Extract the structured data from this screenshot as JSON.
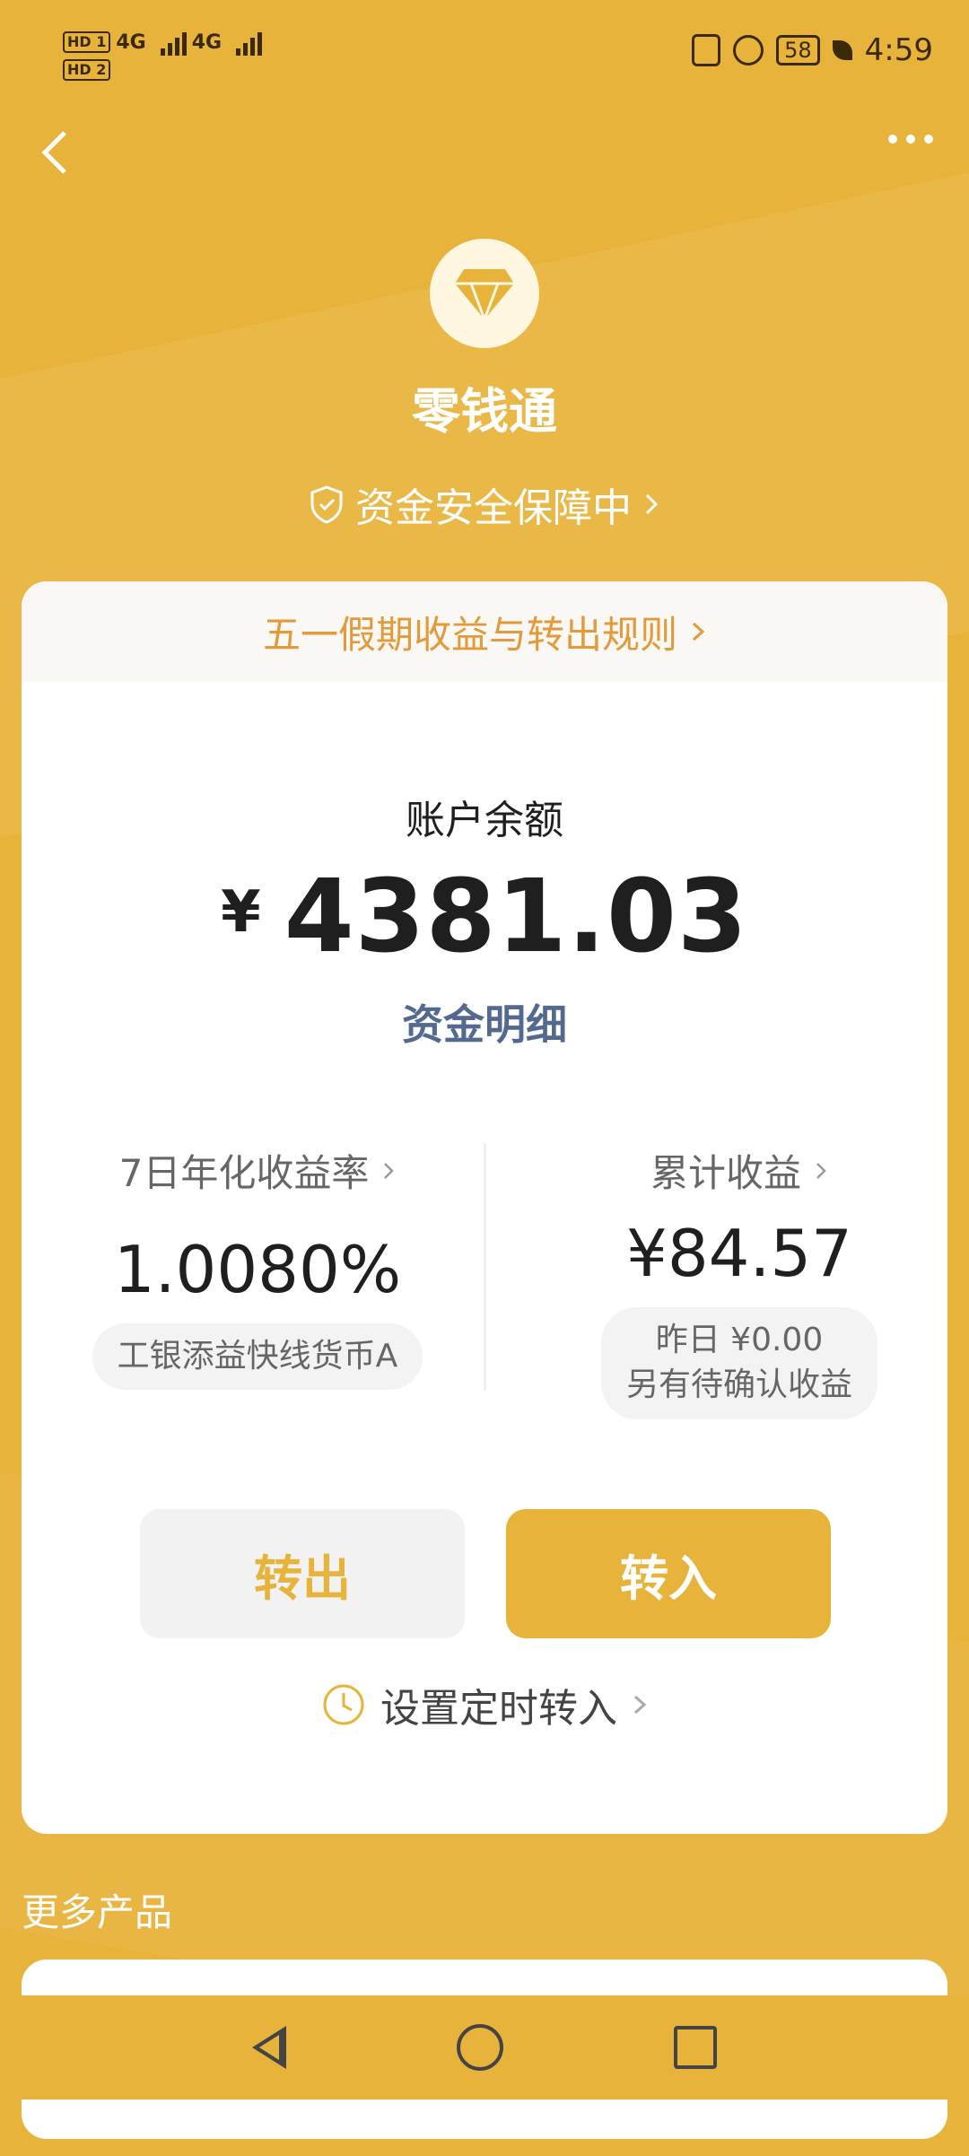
{
  "status_bar": {
    "hd1": "HD 1",
    "hd2": "HD 2",
    "net1": "4G",
    "net2": "4G",
    "battery": "58",
    "time": "4:59"
  },
  "header": {
    "title": "零钱通",
    "safety_text": "资金安全保障中",
    "logo_icon": "diamond-icon"
  },
  "card": {
    "notice_text": "五一假期收益与转出规则",
    "balance_label": "账户余额",
    "currency_symbol": "¥",
    "balance": "4381.03",
    "detail_link": "资金明细",
    "yield": {
      "label": "7日年化收益率",
      "value": "1.0080%",
      "fund_name": "工银添益快线货币A"
    },
    "earnings": {
      "label": "累计收益",
      "value": "¥84.57",
      "yesterday": "昨日 ¥0.00",
      "pending": "另有待确认收益"
    },
    "transfer_out": "转出",
    "transfer_in": "转入",
    "schedule_text": "设置定时转入"
  },
  "more_products_title": "更多产品",
  "colors": {
    "accent": "#E8B33A",
    "notice_orange": "#E39A3A",
    "link_blue": "#53698F"
  }
}
